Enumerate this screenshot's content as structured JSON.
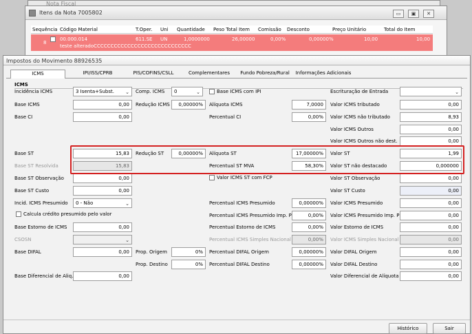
{
  "bg_window": {
    "title": "Nota Fiscal"
  },
  "items_window": {
    "title": "Itens da Nota 7005802",
    "columns": [
      "Sequência",
      "Código Material",
      "T.Oper.",
      "Uni",
      "Quantidade",
      "Peso Total Item",
      "Comissão",
      "Desconto",
      "Preço Unitário",
      "Total do Item"
    ],
    "row": {
      "seq": "8",
      "codigo": "00.000.014",
      "toper": "611.SE",
      "uni": "UN",
      "quantidade": "1,0000000",
      "peso": "26,00000",
      "comissao": "0,00%",
      "desconto": "0,00000%",
      "preco": "10,00",
      "total": "10,00",
      "desc": "teste alteradoCCCCCCCCCCCCCCCCCCCCCCCCCCCCC"
    }
  },
  "main_window": {
    "title": "Impostos do Movimento 88926535"
  },
  "tabs": [
    "ICMS",
    "IPI/ISS/CPRB",
    "PIS/COFINS/CSLL",
    "Complementares",
    "Fundo Pobreza/Rural",
    "Informações Adicionais"
  ],
  "section": "ICMS",
  "col1": {
    "incidencia_label": "Incidência ICMS",
    "incidencia_value": "3 Isenta+Subst.",
    "base_icms_label": "Base ICMS",
    "base_icms": "0,00",
    "base_ci_label": "Base CI",
    "base_ci": "0,00",
    "base_st_label": "Base ST",
    "base_st": "15,83",
    "base_st_resolvida_label": "Base ST Resolvida",
    "base_st_resolvida": "15,83",
    "base_st_obs_label": "Base ST Observação",
    "base_st_obs": "0,00",
    "base_st_custo_label": "Base ST Custo",
    "base_st_custo": "0,00",
    "incid_presumido_label": "Incid. ICMS Presumido",
    "incid_presumido": "0 - Não",
    "calc_credito_label": "Calcula crédito presumido pelo valor",
    "base_estorno_label": "Base Estorno de ICMS",
    "base_estorno": "0,00",
    "csosn_label": "CSOSN",
    "base_difal_label": "Base DIFAL",
    "base_difal": "0,00",
    "base_dif_aliq_label": "Base Diferencial de Aliq.",
    "base_dif_aliq": "0,00"
  },
  "col2": {
    "comp_icms_label": "Comp. ICMS",
    "comp_icms": "0",
    "reducao_icms_label": "Redução ICMS",
    "reducao_icms": "0,00000%",
    "reducao_st_label": "Redução ST",
    "reducao_st": "0,00000%",
    "prop_origem_label": "Prop. Origem",
    "prop_origem": "0%",
    "prop_destino_label": "Prop. Destino",
    "prop_destino": "0%"
  },
  "col3": {
    "base_icms_ipi_label": "Base ICMS com IPI",
    "aliquota_icms_label": "Alíquota ICMS",
    "aliquota_icms": "7,0000",
    "percentual_ci_label": "Percentual CI",
    "percentual_ci": "0,00%",
    "aliquota_st_label": "Alíquota ST",
    "aliquota_st": "17,00000%",
    "perc_st_mva_label": "Percentual ST MVA",
    "perc_st_mva": "58,30%",
    "valor_icms_st_fcp_label": "Valor ICMS ST com FCP",
    "perc_presumido_label": "Percentual ICMS Presumido",
    "perc_presumido": "0,00000%",
    "perc_presumido_pr_label": "Percentual ICMS Presumido Imp. PR",
    "perc_presumido_pr": "0,00%",
    "perc_estorno_label": "Percentual Estorno de ICMS",
    "perc_estorno": "0,00%",
    "perc_simples_label": "Percentual ICMS Simples Nacional",
    "perc_simples": "0,00%",
    "perc_difal_origem_label": "Percentual DIFAL Origem",
    "perc_difal_origem": "0,00000%",
    "perc_difal_destino_label": "Percentual DIFAL Destino",
    "perc_difal_destino": "0,00000%"
  },
  "col4": {
    "escrituracao_label": "Escrituração de Entrada",
    "valor_icms_trib_label": "Valor ICMS tributado",
    "valor_icms_trib": "0,00",
    "valor_icms_nao_trib_label": "Valor ICMS não tributado",
    "valor_icms_nao_trib": "8,93",
    "valor_icms_outros_label": "Valor ICMS Outros",
    "valor_icms_outros": "0,00",
    "valor_icms_outros_nd_label": "Valor ICMS Outros não dest.",
    "valor_icms_outros_nd": "0,00",
    "valor_st_label": "Valor ST",
    "valor_st": "1,99",
    "valor_st_nd_label": "Valor ST não destacado",
    "valor_st_nd": "0,000000",
    "valor_st_obs_label": "Valor ST Observação",
    "valor_st_obs": "0,00",
    "valor_st_custo_label": "Valor ST Custo",
    "valor_st_custo": "0,00",
    "valor_presumido_label": "Valor ICMS Presumido",
    "valor_presumido": "0,00",
    "valor_presumido_pr_label": "Valor ICMS Presumido Imp. PR",
    "valor_presumido_pr": "0,00",
    "valor_estorno_label": "Valor Estorno de ICMS",
    "valor_estorno": "0,00",
    "valor_simples_label": "Valor ICMS Simples Nacional",
    "valor_simples": "0,00",
    "valor_difal_origem_label": "Valor DIFAL Origem",
    "valor_difal_origem": "0,00",
    "valor_difal_destino_label": "Valor DIFAL Destino",
    "valor_difal_destino": "0,00",
    "valor_dif_aliquota_label": "Valor Diferencial de Alíquota",
    "valor_dif_aliquota": "0,00"
  },
  "buttons": {
    "historico": "Histórico",
    "sair": "Sair"
  },
  "colors": {
    "highlight": "#d42020",
    "selected_row": "#f47c7c"
  }
}
